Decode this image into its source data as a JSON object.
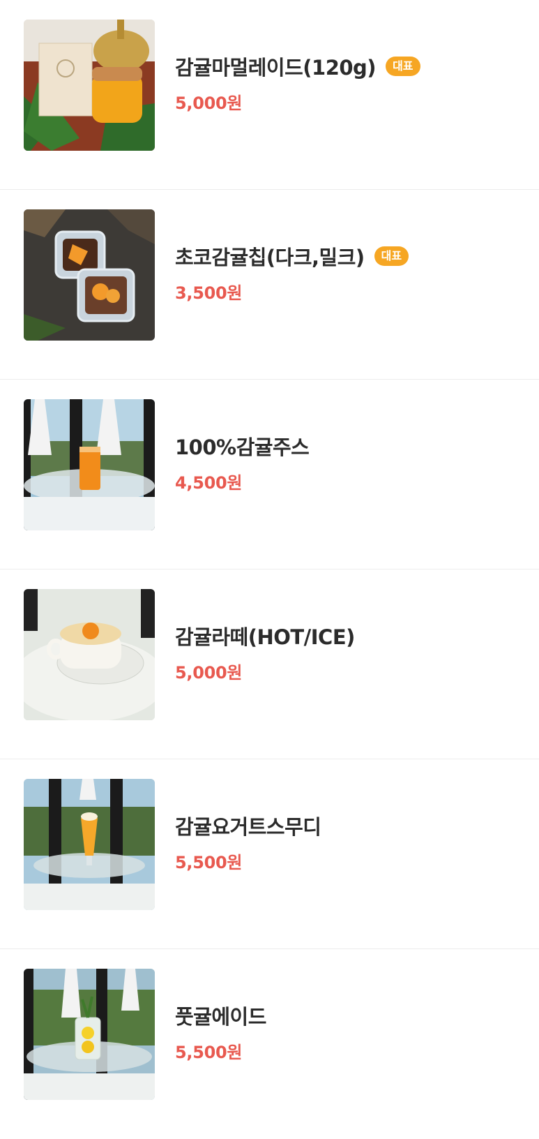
{
  "menu": {
    "items": [
      {
        "name": "감귤마멀레이드(120g)",
        "badge": "대표",
        "price": "5,000원",
        "image": "marmalade-jar-photo"
      },
      {
        "name": "초코감귤칩(다크,밀크)",
        "badge": "대표",
        "price": "3,500원",
        "image": "choco-tangerine-chips-photo"
      },
      {
        "name": "100%감귤주스",
        "badge": "",
        "price": "4,500원",
        "image": "tangerine-juice-photo"
      },
      {
        "name": "감귤라떼(HOT/ICE)",
        "badge": "",
        "price": "5,000원",
        "image": "tangerine-latte-photo"
      },
      {
        "name": "감귤요거트스무디",
        "badge": "",
        "price": "5,500원",
        "image": "tangerine-yogurt-smoothie-photo"
      },
      {
        "name": "풋귤에이드",
        "badge": "",
        "price": "5,500원",
        "image": "green-tangerine-ade-photo"
      }
    ]
  },
  "colors": {
    "price": "#e8594f",
    "badge_bg": "#f6a623",
    "name": "#2b2b2b"
  }
}
